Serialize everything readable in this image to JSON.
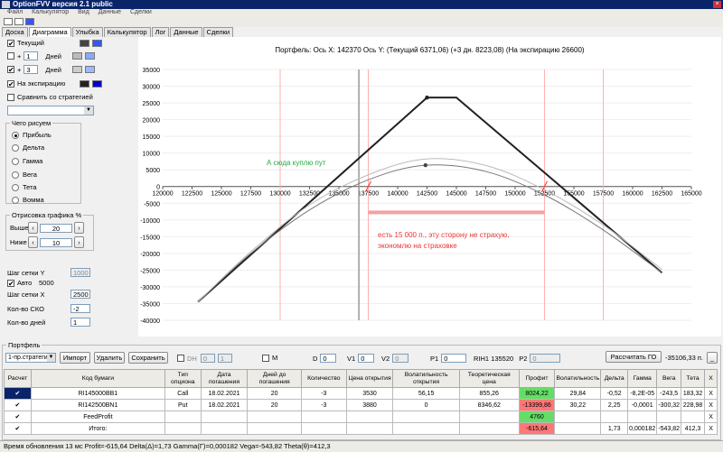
{
  "window": {
    "title": "OptionFVV версия 2.1 public"
  },
  "menu": [
    "Файл",
    "Калькулятор",
    "Вид",
    "Данные",
    "Сделки"
  ],
  "tabs": [
    "Доска",
    "Диаграмма",
    "Улыбка",
    "Калькулятор",
    "Лог",
    "Данные",
    "Сделки"
  ],
  "active_tab": "Диаграмма",
  "left": {
    "current_label": "Текущий",
    "plus": "+",
    "days1": "1",
    "days_label": "Дней",
    "days2": "3",
    "expiry_label": "На экспирацию",
    "compare_label": "Сравнить со стратегией",
    "draw_group": "Чего рисуем",
    "draw_options": [
      "Прибыль",
      "Дельта",
      "Гамма",
      "Вега",
      "Тета",
      "Вомма"
    ],
    "render_group": "Отрисовка графика %",
    "above_label": "Выше",
    "above_value": "20",
    "below_label": "Ниже",
    "below_value": "10",
    "grid_y_label": "Шаг сетки Y",
    "grid_y_value": "1000",
    "auto_label": "Авто",
    "auto_value": "5000",
    "grid_x_label": "Шаг сетки X",
    "grid_x_value": "2500",
    "sko_label": "Кол-во СКО",
    "sko_value": "-2",
    "ndays_label": "Кол-во дней",
    "ndays_value": "1",
    "colors": {
      "current1": "#444444",
      "current2": "#3355ff",
      "plus1a": "#bbbbbb",
      "plus1b": "#88aaff",
      "plus2a": "#cccccc",
      "plus2b": "#99bbff",
      "exp1": "#222222",
      "exp2": "#0000cc"
    }
  },
  "chart_header": "Портфель: Ось X: 142370 Ось Y: (Текущий 6371,06) (+3 дн. 8223,08) (На экспирацию 26600)",
  "annotations": {
    "green": "А сюда куплю пут",
    "red": "есть 15 000 п., эту сторону не страхую, экономлю на страховке"
  },
  "chart_data": {
    "type": "line",
    "title": "Портфель: Ось X: 142370 Ось Y: (Текущий 6371,06) (+3 дн. 8223,08) (На экспирацию 26600)",
    "xlim": [
      120000,
      165000
    ],
    "ylim": [
      -40000,
      35000
    ],
    "x_ticks": [
      "120000",
      "122500",
      "125000",
      "127500",
      "130000",
      "132500",
      "135000",
      "137500",
      "140000",
      "142500",
      "145000",
      "147500",
      "150000",
      "152500",
      "155000",
      "157500",
      "160000",
      "162500",
      "165000"
    ],
    "y_ticks": [
      "35000",
      "30000",
      "25000",
      "20000",
      "15000",
      "10000",
      "5000",
      "0",
      "-5000",
      "-10000",
      "-15000",
      "-20000",
      "-25000",
      "-30000",
      "-35000",
      "-40000"
    ],
    "series": [
      {
        "name": "На экспирацию",
        "x": [
          123000,
          142500,
          145000,
          162500
        ],
        "y": [
          -34500,
          26600,
          26600,
          -25800
        ]
      },
      {
        "name": "Текущий",
        "x": [
          123000,
          127500,
          132500,
          137500,
          142370,
          147500,
          152500,
          157500,
          162500
        ],
        "y": [
          -34500,
          -20000,
          -7000,
          2000,
          6371,
          4500,
          -2500,
          -13000,
          -25800
        ]
      },
      {
        "name": "+3 дн.",
        "x": [
          123000,
          127500,
          132500,
          137500,
          142370,
          147500,
          152500,
          157500,
          162500
        ],
        "y": [
          -34500,
          -19500,
          -5500,
          3500,
          8223,
          6300,
          -1000,
          -11500,
          -24800
        ]
      }
    ],
    "vlines_red": [
      130000,
      137500,
      152500,
      157500
    ],
    "vline_gray": 136700,
    "grid": true
  },
  "portfolio": {
    "group_label": "Портфель",
    "strategy": "1-пр.стратегия",
    "import_btn": "Импорт",
    "delete_btn": "Удалить",
    "save_btn": "Сохранить",
    "dh_label": "DH",
    "dh_a": "0",
    "dh_b": "1",
    "m_label": "M",
    "d_label": "D",
    "d_val": "0",
    "v1_label": "V1",
    "v1_val": "0",
    "v2_label": "V2",
    "v2_val": "0",
    "p1_label": "P1",
    "p1_val": "0",
    "ri_label": "RIH1 135520",
    "p2_label": "P2",
    "p2_val": "0",
    "calc_btn": "Рассчитать ГО",
    "go_value": "-35106,33 п."
  },
  "table": {
    "headers": [
      "Расчет",
      "Код бумаги",
      "Тип опциона",
      "Дата погашения",
      "Дней до погашения",
      "Количество",
      "Цена открытия",
      "Волатильность открытия",
      "Теоретическая цена",
      "Профит",
      "Волатильность",
      "Дельта",
      "Гамма",
      "Вега",
      "Тета",
      "X"
    ],
    "rows": [
      [
        "✔",
        "RI145000BB1",
        "Call",
        "18.02.2021",
        "20",
        "-3",
        "3530",
        "56,15",
        "855,26",
        "8024,22",
        "29,84",
        "-0,52",
        "-8,2E-05",
        "-243,5",
        "183,32",
        "X"
      ],
      [
        "✔",
        "RI142500BN1",
        "Put",
        "18.02.2021",
        "20",
        "-3",
        "3880",
        "0",
        "8346,62",
        "-13399,86",
        "30,22",
        "2,25",
        "-0,0001",
        "-300,32",
        "228,98",
        "X"
      ],
      [
        "✔",
        "FeedProfit",
        "",
        "",
        "",
        "",
        "",
        "",
        "",
        "4760",
        "",
        "",
        "",
        "",
        "",
        "X"
      ],
      [
        "✔",
        "Итого:",
        "",
        "",
        "",
        "",
        "",
        "",
        "",
        "-615,64",
        "",
        "1,73",
        "0,000182",
        "-543,82",
        "412,3",
        "X"
      ]
    ]
  },
  "status": "Время обновления 13 мс  Profit=-615,64 Delta(Δ)=1,73 Gamma(Γ)=0,000182 Vega=-543,82 Theta(θ)=412,3"
}
